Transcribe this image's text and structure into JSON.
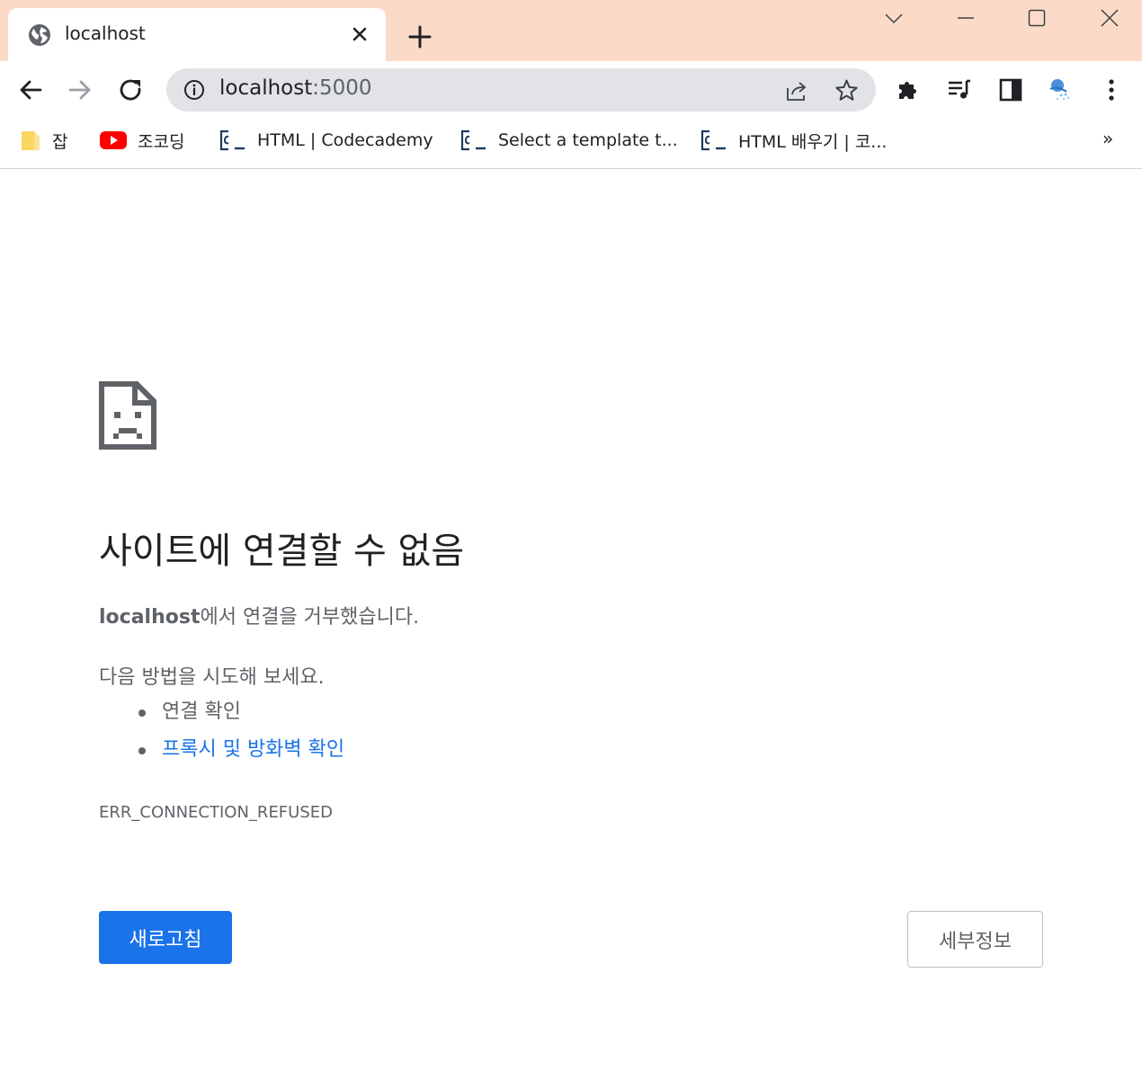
{
  "tab": {
    "title": "localhost",
    "favicon": "globe-icon"
  },
  "omnibox": {
    "host": "localhost",
    "port": ":5000"
  },
  "bookmarks": [
    {
      "label": "잡",
      "icon": "folder-icon"
    },
    {
      "label": "조코딩",
      "icon": "youtube-icon"
    },
    {
      "label": "HTML | Codecademy",
      "icon": "codecademy-icon"
    },
    {
      "label": "Select a template t...",
      "icon": "codecademy-icon"
    },
    {
      "label": "HTML 배우기 | 코...",
      "icon": "codecademy-icon"
    }
  ],
  "bookmarks_more": "»",
  "error": {
    "title": "사이트에 연결할 수 없음",
    "host": "localhost",
    "desc_suffix": "에서 연결을 거부했습니다.",
    "try_heading": "다음 방법을 시도해 보세요.",
    "suggestions": [
      "연결 확인",
      "프록시 및 방화벽 확인"
    ],
    "code": "ERR_CONNECTION_REFUSED",
    "reload_label": "새로고침",
    "details_label": "세부정보"
  },
  "colors": {
    "titlebar": "#fbdbc8",
    "link": "#1a73e8",
    "primary_button": "#1a73e8",
    "secondary_text": "#5f6368"
  }
}
